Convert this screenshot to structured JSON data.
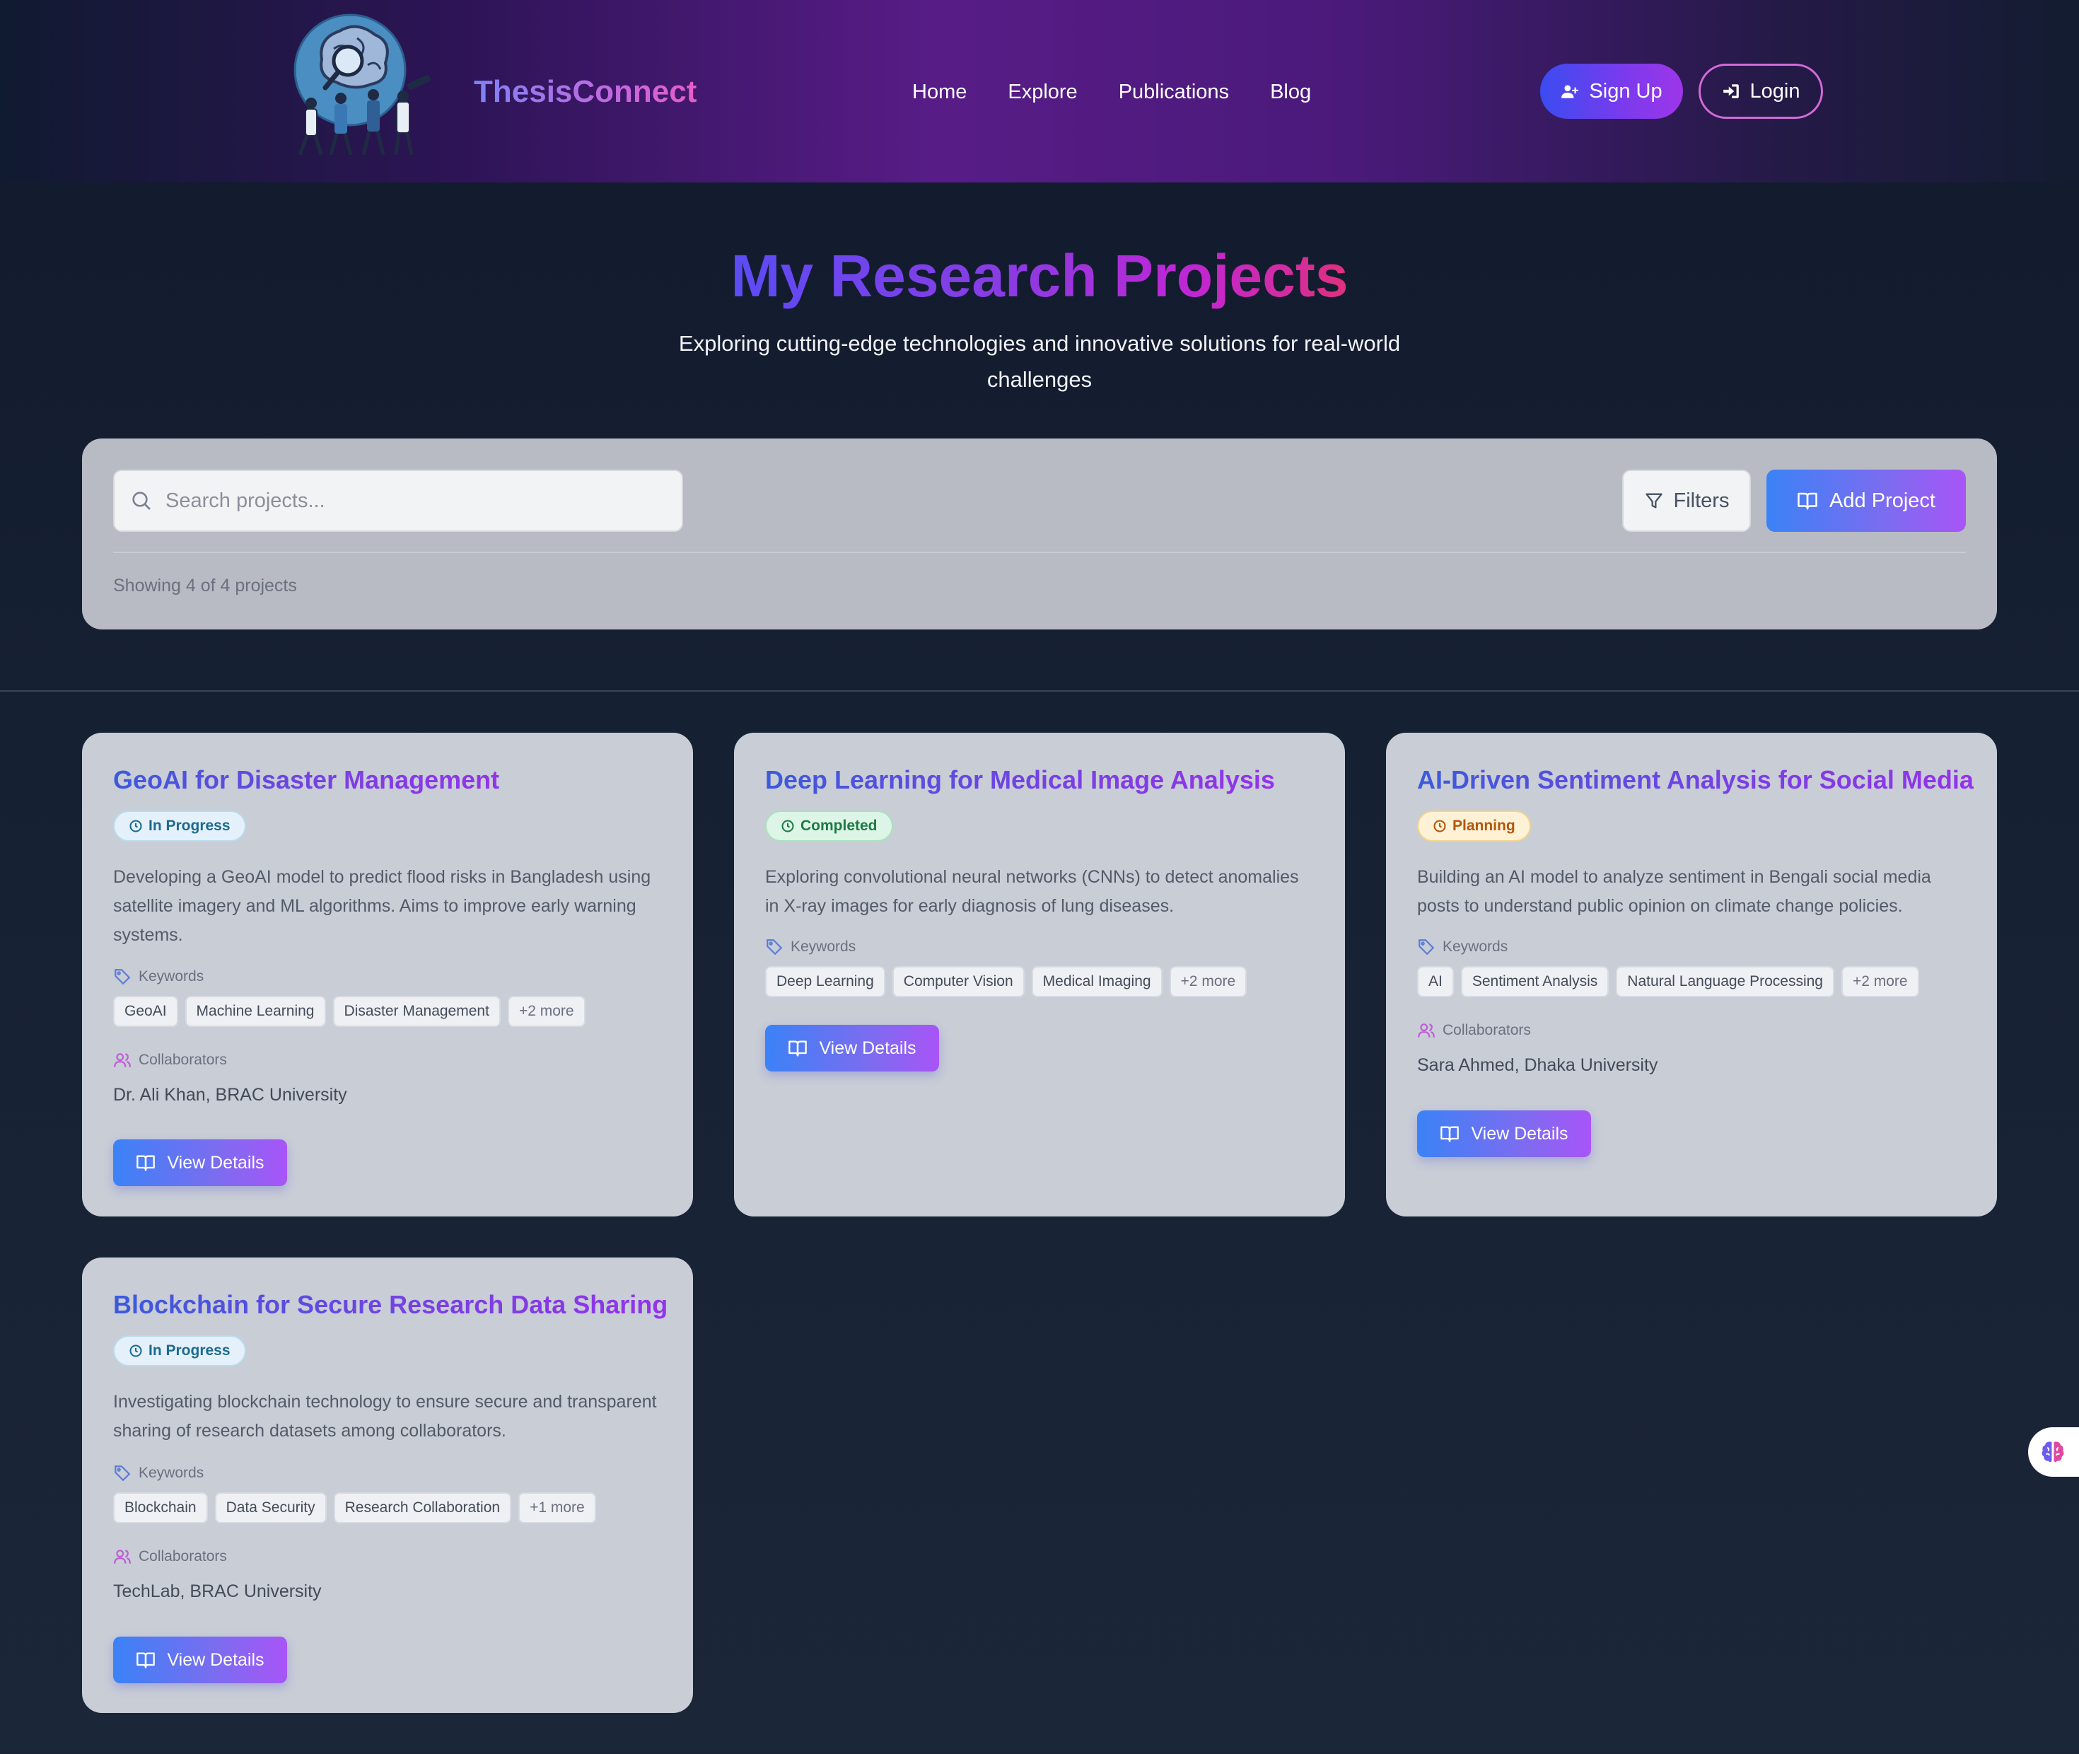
{
  "header": {
    "brand": "ThesisConnect",
    "nav": [
      "Home",
      "Explore",
      "Publications",
      "Blog"
    ],
    "signup_label": "Sign Up",
    "login_label": "Login"
  },
  "hero": {
    "title": "My Research Projects",
    "subtitle": "Exploring cutting-edge technologies and innovative solutions for real-world challenges"
  },
  "toolbar": {
    "search_placeholder": "Search projects...",
    "filters_label": "Filters",
    "add_label": "Add Project",
    "showing_text": "Showing 4 of 4 projects"
  },
  "labels": {
    "keywords": "Keywords",
    "collaborators": "Collaborators",
    "view_details": "View Details"
  },
  "projects": [
    {
      "title": "GeoAI for Disaster Management",
      "status": "In Progress",
      "description": "Developing a GeoAI model to predict flood risks in Bangladesh using satellite imagery and ML algorithms. Aims to improve early warning systems.",
      "keywords": [
        "GeoAI",
        "Machine Learning",
        "Disaster Management"
      ],
      "more": "+2 more",
      "collaborators": "Dr. Ali Khan, BRAC University"
    },
    {
      "title": "Deep Learning for Medical Image Analysis",
      "status": "Completed",
      "description": "Exploring convolutional neural networks (CNNs) to detect anomalies in X-ray images for early diagnosis of lung diseases.",
      "keywords": [
        "Deep Learning",
        "Computer Vision",
        "Medical Imaging"
      ],
      "more": "+2 more",
      "collaborators": ""
    },
    {
      "title": "AI-Driven Sentiment Analysis for Social Media",
      "status": "Planning",
      "description": "Building an AI model to analyze sentiment in Bengali social media posts to understand public opinion on climate change policies.",
      "keywords": [
        "AI",
        "Sentiment Analysis",
        "Natural Language Processing"
      ],
      "more": "+2 more",
      "collaborators": "Sara Ahmed, Dhaka University"
    },
    {
      "title": "Blockchain for Secure Research Data Sharing",
      "status": "In Progress",
      "description": "Investigating blockchain technology to ensure secure and transparent sharing of research datasets among collaborators.",
      "keywords": [
        "Blockchain",
        "Data Security",
        "Research Collaboration"
      ],
      "more": "+1 more",
      "collaborators": "TechLab, BRAC University"
    }
  ],
  "colors": {
    "accent_blue": "#3b82f6",
    "accent_purple": "#a855f7",
    "status_in_progress": "#1d6a8e",
    "status_completed": "#1f7a44",
    "status_planning": "#b4560a"
  }
}
